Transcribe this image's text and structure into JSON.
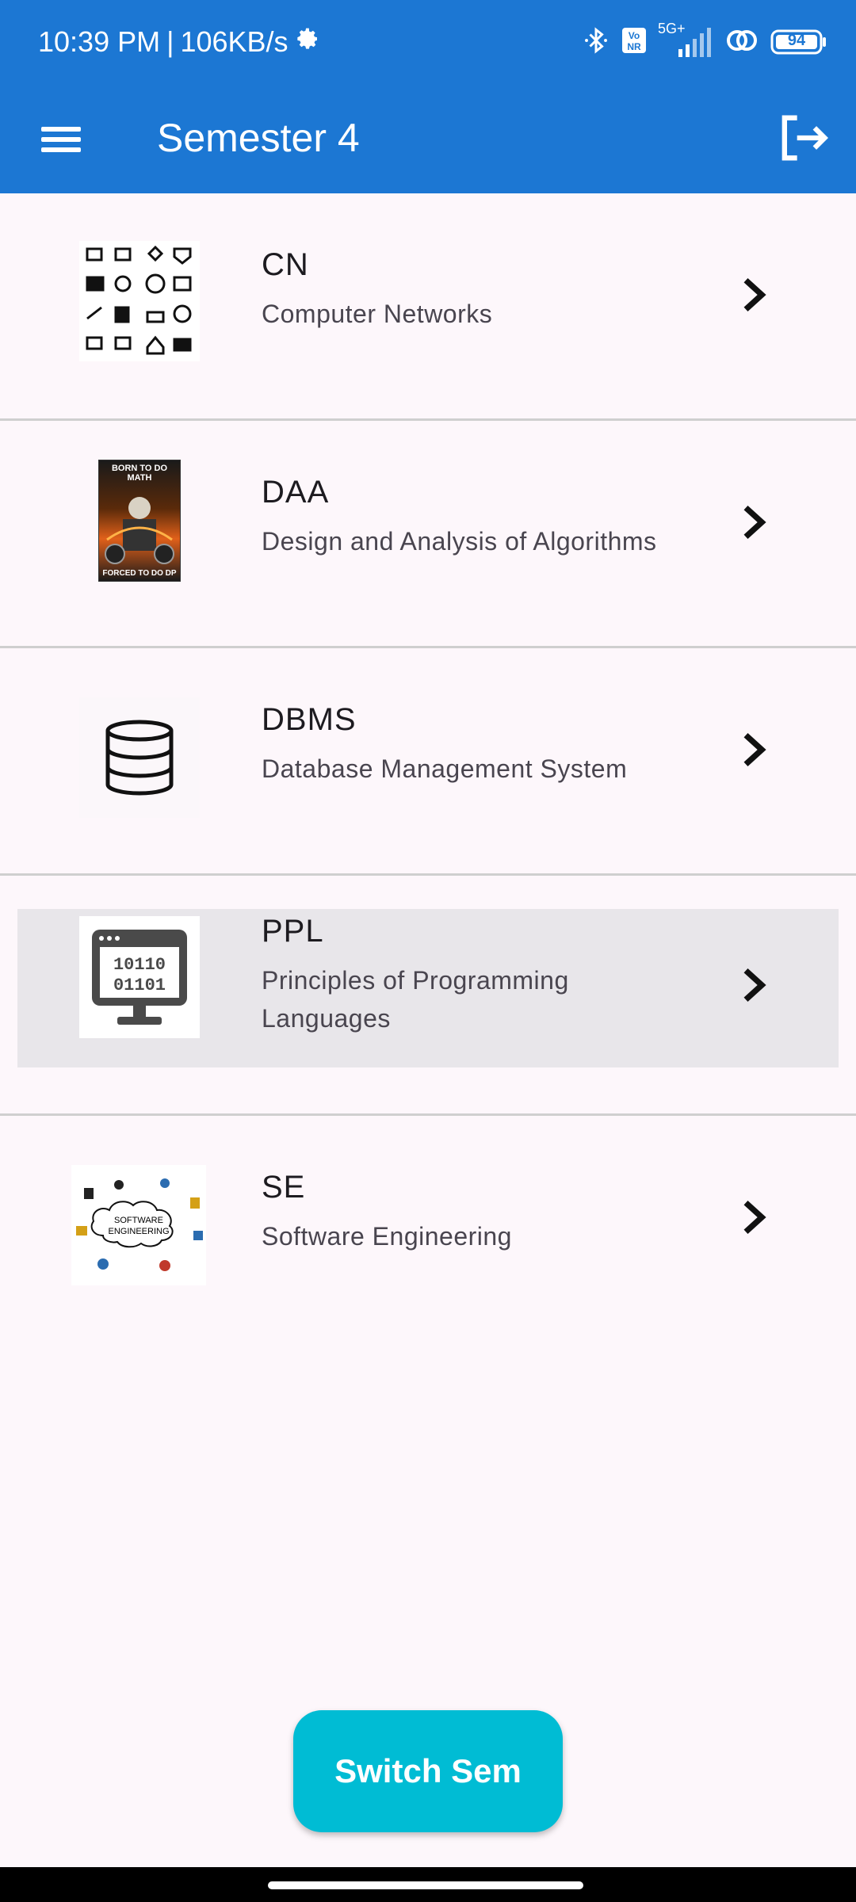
{
  "status_bar": {
    "time": "10:39 PM",
    "separator": "|",
    "speed": "106KB/s",
    "network": "5G+",
    "volte": "Vo NR",
    "battery": "94",
    "icons": [
      "gear-icon",
      "bluetooth-icon",
      "vonr-icon",
      "signal-icon",
      "link-icon",
      "battery-icon"
    ]
  },
  "app_bar": {
    "title": "Semester 4",
    "menu_icon": "hamburger-menu-icon",
    "logout_icon": "logout-icon"
  },
  "subjects": [
    {
      "code": "CN",
      "name": "Computer Networks",
      "thumb": "network-icons-grid"
    },
    {
      "code": "DAA",
      "name": "Design and Analysis of Algorithms",
      "thumb": "poster-image",
      "poster_top": "BORN TO DO MATH",
      "poster_bottom": "FORCED TO DO DP"
    },
    {
      "code": "DBMS",
      "name": "Database Management System",
      "thumb": "database-icon"
    },
    {
      "code": "PPL",
      "name": "Principles of Programming Languages",
      "thumb": "binary-monitor-icon",
      "binary_top": "10110",
      "binary_bottom": "01101"
    },
    {
      "code": "SE",
      "name": "Software Engineering",
      "thumb": "software-engineering-cloud",
      "cloud_text_1": "SOFTWARE",
      "cloud_text_2": "ENGINEERING"
    }
  ],
  "fab": {
    "label": "Switch Sem"
  },
  "colors": {
    "app_bar": "#1c77d3",
    "fab": "#00bcd4",
    "background": "#fdf7fb",
    "selected_row": "#e8e6ea"
  }
}
